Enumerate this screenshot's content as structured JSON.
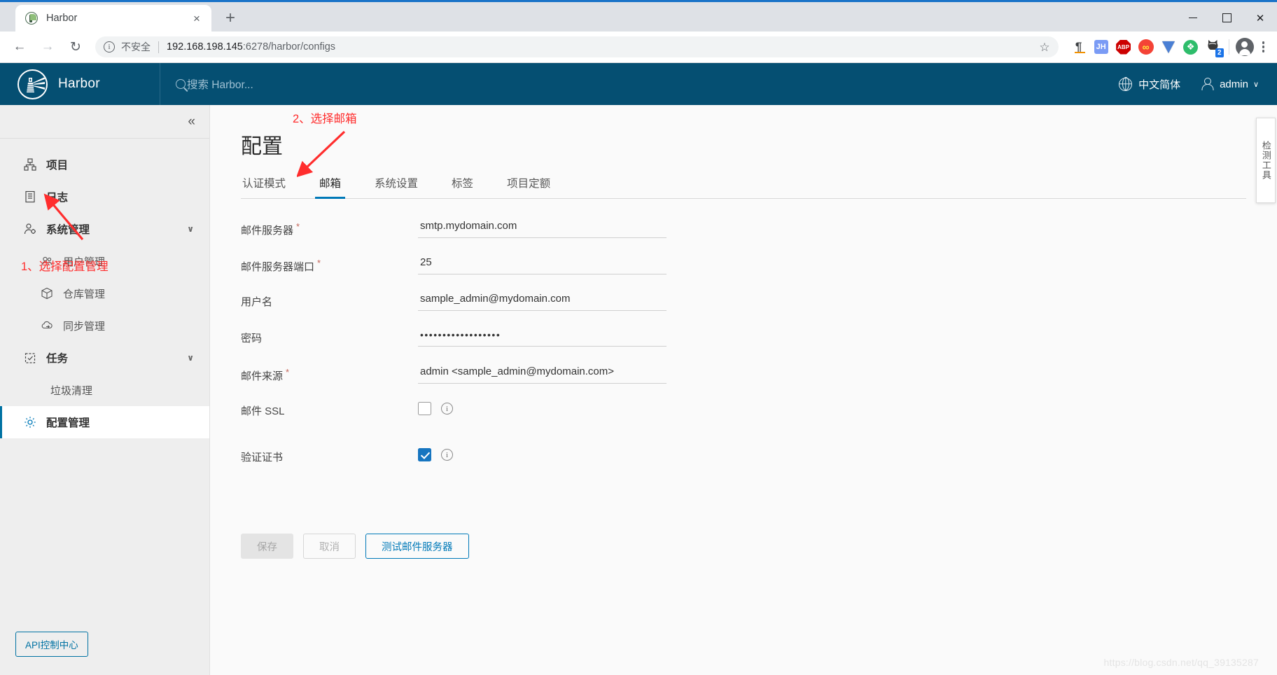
{
  "browser": {
    "tab": {
      "title": "Harbor",
      "favicon": "harbor-favicon",
      "close": "×"
    },
    "new_tab": "+",
    "window_controls": {
      "minimize": "minimize",
      "maximize": "maximize",
      "close": "✕"
    },
    "nav": {
      "back": "←",
      "forward": "→",
      "reload": "↻"
    },
    "omnibox": {
      "security_icon": "i",
      "security_label": "不安全",
      "url_host": "192.168.198.145",
      "url_path": ":6278/harbor/configs",
      "bookmark_star": "☆"
    },
    "extensions": [
      {
        "name": "paragraph-translate-icon",
        "glyph": "¶"
      },
      {
        "name": "jh-extension-icon",
        "glyph": "JH"
      },
      {
        "name": "adblock-plus-icon",
        "glyph": "ABP"
      },
      {
        "name": "infinity-extension-icon",
        "glyph": "∞"
      },
      {
        "name": "diamond-extension-icon",
        "glyph": ""
      },
      {
        "name": "puzzle-extension-icon",
        "glyph": "❖"
      },
      {
        "name": "cat-extension-icon",
        "glyph": "🐱",
        "badge": "2"
      }
    ],
    "profile": "profile-avatar",
    "menu": "chrome-menu"
  },
  "harbor": {
    "brand": "Harbor",
    "search_placeholder": "搜索 Harbor...",
    "language": "中文简体",
    "user": "admin",
    "user_chevron": "∨"
  },
  "sidebar": {
    "collapse_icon": "«",
    "items": [
      {
        "label": "项目",
        "icon": "projects-icon",
        "level": "top",
        "active": false,
        "expandable": false
      },
      {
        "label": "日志",
        "icon": "logs-icon",
        "level": "top",
        "active": false,
        "expandable": false
      },
      {
        "label": "系统管理",
        "icon": "admin-icon",
        "level": "top",
        "active": false,
        "expandable": true,
        "chevron": "∨"
      },
      {
        "label": "用户管理",
        "icon": "users-icon",
        "level": "sub",
        "active": false,
        "expandable": false
      },
      {
        "label": "仓库管理",
        "icon": "registry-icon",
        "level": "sub",
        "active": false,
        "expandable": false
      },
      {
        "label": "同步管理",
        "icon": "replication-icon",
        "level": "sub",
        "active": false,
        "expandable": false
      },
      {
        "label": "任务",
        "icon": "tasks-icon",
        "level": "top",
        "active": false,
        "expandable": true,
        "chevron": "∨"
      },
      {
        "label": "垃圾清理",
        "icon": "",
        "level": "sub-plain",
        "active": false,
        "expandable": false
      },
      {
        "label": "配置管理",
        "icon": "gear-icon",
        "level": "top",
        "active": true,
        "expandable": false
      }
    ],
    "annotation_1": "1、选择配置管理",
    "api_button": "API控制中心"
  },
  "main": {
    "page_title": "配置",
    "annotation_2": "2、选择邮箱",
    "tabs": [
      {
        "label": "认证模式",
        "active": false
      },
      {
        "label": "邮箱",
        "active": true
      },
      {
        "label": "系统设置",
        "active": false
      },
      {
        "label": "标签",
        "active": false
      },
      {
        "label": "项目定额",
        "active": false
      }
    ],
    "fields": [
      {
        "label": "邮件服务器",
        "required": true,
        "type": "text",
        "value": "smtp.mydomain.com",
        "name": "mail-server-input"
      },
      {
        "label": "邮件服务器端口",
        "required": true,
        "type": "text",
        "value": "25",
        "name": "mail-server-port-input"
      },
      {
        "label": "用户名",
        "required": false,
        "type": "text",
        "value": "sample_admin@mydomain.com",
        "name": "username-input"
      },
      {
        "label": "密码",
        "required": false,
        "type": "password",
        "value": "••••••••••••••••••",
        "name": "password-input"
      },
      {
        "label": "邮件来源",
        "required": true,
        "type": "text",
        "value": "admin <sample_admin@mydomain.com>",
        "name": "mail-from-input"
      }
    ],
    "checkboxes": [
      {
        "label": "邮件 SSL",
        "checked": false,
        "name": "mail-ssl-checkbox"
      },
      {
        "label": "验证证书",
        "checked": true,
        "name": "verify-certificate-checkbox"
      }
    ],
    "buttons": [
      {
        "label": "保存",
        "style": "disabled",
        "name": "save-button"
      },
      {
        "label": "取消",
        "style": "outline-disabled",
        "name": "cancel-button"
      },
      {
        "label": "测试邮件服务器",
        "style": "primary-outline",
        "name": "test-mail-server-button"
      }
    ],
    "vertical_panel": "检测工具",
    "watermark": "https://blog.csdn.net/qq_39135287"
  },
  "colors": {
    "harbor_header": "#054f72",
    "accent_blue": "#0079b8",
    "annotation_red": "#ff2d2d",
    "sidebar_bg": "#eeeeee"
  }
}
